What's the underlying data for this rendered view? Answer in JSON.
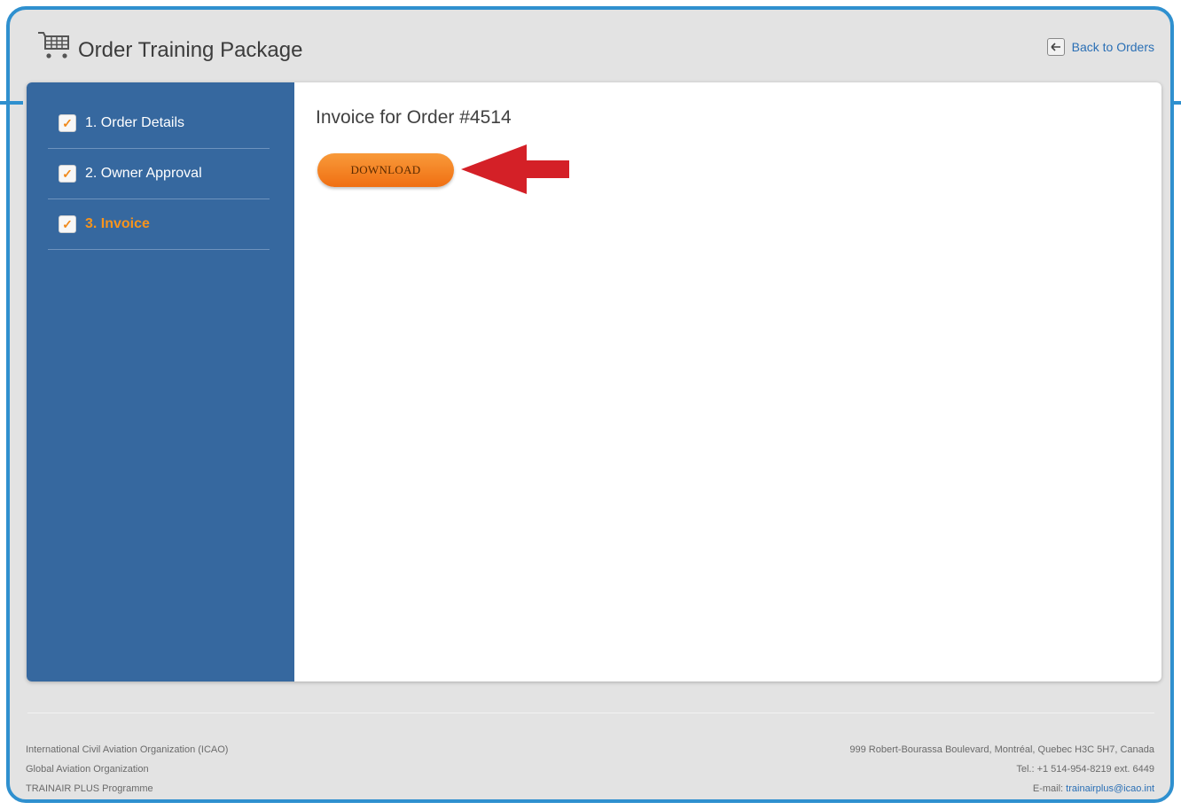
{
  "header": {
    "title": "Order Training Package",
    "back_label": "Back to Orders",
    "cart_icon": "shopping-cart-icon",
    "back_icon": "arrow-left-icon"
  },
  "sidebar": {
    "steps": [
      {
        "label": "1. Order Details",
        "checked": true,
        "active": false
      },
      {
        "label": "2. Owner Approval",
        "checked": true,
        "active": false
      },
      {
        "label": "3. Invoice",
        "checked": true,
        "active": true
      }
    ]
  },
  "main": {
    "title": "Invoice for Order #4514",
    "download_label": "DOWNLOAD"
  },
  "footer": {
    "left": [
      "International Civil Aviation Organization (ICAO)",
      "Global Aviation Organization",
      "TRAINAIR PLUS Programme"
    ],
    "address": "999 Robert-Bourassa Boulevard, Montréal, Quebec H3C 5H7, Canada",
    "tel": "Tel.: +1 514-954-8219 ext. 6449",
    "email_prefix": "E-mail: ",
    "email": "trainairplus@icao.int"
  },
  "colors": {
    "frame": "#2f90cf",
    "sidebar": "#36689f",
    "accent": "#f7941d",
    "annotation_arrow": "#d42027"
  }
}
